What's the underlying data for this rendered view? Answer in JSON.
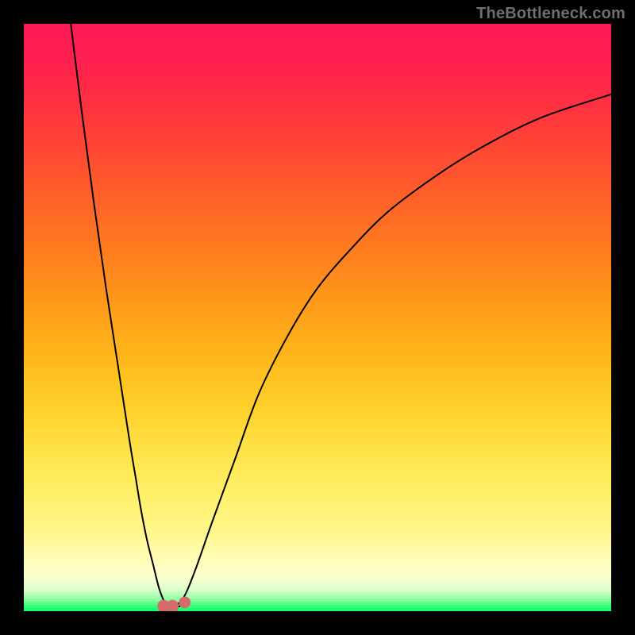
{
  "watermark": "TheBottleneck.com",
  "chart_data": {
    "type": "line",
    "title": "",
    "xlabel": "",
    "ylabel": "",
    "xlim": [
      0,
      100
    ],
    "ylim": [
      0,
      100
    ],
    "grid": false,
    "legend": false,
    "series": [
      {
        "name": "curve-left",
        "x": [
          8,
          10,
          12,
          14,
          16,
          18,
          19,
          20,
          21,
          22,
          23,
          24,
          25,
          27
        ],
        "y": [
          100,
          84,
          69,
          55,
          42,
          29,
          23,
          17,
          12,
          8,
          4,
          1.5,
          0.5,
          1
        ]
      },
      {
        "name": "curve-right",
        "x": [
          25,
          27,
          29,
          32,
          36,
          40,
          45,
          50,
          56,
          62,
          70,
          78,
          88,
          100
        ],
        "y": [
          0.5,
          2,
          6.5,
          15,
          26,
          37,
          47,
          55,
          62,
          68,
          74,
          79,
          84,
          88
        ]
      }
    ],
    "markers": [
      {
        "name": "dot-right",
        "x": 27.4,
        "y": 1.5,
        "r_pct": 1.0,
        "color": "#d66b6b"
      },
      {
        "name": "blob-left",
        "x": 23.8,
        "y": 0.9,
        "r_pct": 1.05,
        "color": "#d66b6b"
      },
      {
        "name": "blob-mid",
        "x": 24.0,
        "y": 0.2,
        "r_pct": 1.05,
        "color": "#d66b6b"
      },
      {
        "name": "blob-right",
        "x": 25.1,
        "y": 0.2,
        "r_pct": 1.05,
        "color": "#d66b6b"
      },
      {
        "name": "blob-top",
        "x": 25.3,
        "y": 0.9,
        "r_pct": 1.05,
        "color": "#d66b6b"
      }
    ],
    "background_gradient": {
      "stops": [
        {
          "pos": 0.0,
          "color": "#ff1a55"
        },
        {
          "pos": 0.06,
          "color": "#ff2050"
        },
        {
          "pos": 0.13,
          "color": "#ff3042"
        },
        {
          "pos": 0.2,
          "color": "#ff4436"
        },
        {
          "pos": 0.27,
          "color": "#ff592c"
        },
        {
          "pos": 0.34,
          "color": "#ff6f24"
        },
        {
          "pos": 0.41,
          "color": "#ff851e"
        },
        {
          "pos": 0.48,
          "color": "#ff9c1a"
        },
        {
          "pos": 0.55,
          "color": "#ffb21a"
        },
        {
          "pos": 0.61,
          "color": "#ffc522"
        },
        {
          "pos": 0.67,
          "color": "#ffd531"
        },
        {
          "pos": 0.72,
          "color": "#ffe144"
        },
        {
          "pos": 0.76,
          "color": "#ffea58"
        },
        {
          "pos": 0.8,
          "color": "#fff06a"
        },
        {
          "pos": 0.835,
          "color": "#fff47c"
        },
        {
          "pos": 0.865,
          "color": "#fff78e"
        },
        {
          "pos": 0.89,
          "color": "#fffba2"
        },
        {
          "pos": 0.912,
          "color": "#fffeb8"
        },
        {
          "pos": 0.93,
          "color": "#feffc8"
        },
        {
          "pos": 0.944,
          "color": "#f6ffcf"
        },
        {
          "pos": 0.955,
          "color": "#e8ffce"
        },
        {
          "pos": 0.964,
          "color": "#d4ffc6"
        },
        {
          "pos": 0.971,
          "color": "#baffb8"
        },
        {
          "pos": 0.977,
          "color": "#9cffa8"
        },
        {
          "pos": 0.982,
          "color": "#7dff98"
        },
        {
          "pos": 0.986,
          "color": "#5eff89"
        },
        {
          "pos": 0.99,
          "color": "#40ff7b"
        },
        {
          "pos": 0.994,
          "color": "#26ff70"
        },
        {
          "pos": 1.0,
          "color": "#0bff66"
        }
      ]
    },
    "curve_color": "#000000"
  }
}
